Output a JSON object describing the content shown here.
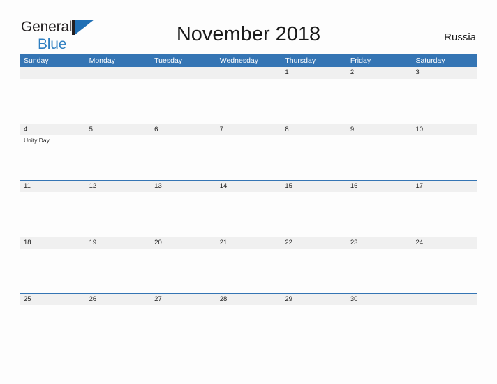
{
  "brand": {
    "name_part1": "General",
    "name_part2": "Blue",
    "mark_icon": "triangle-flag-icon",
    "accent_color": "#2f7fc1"
  },
  "header": {
    "title": "November 2018",
    "country": "Russia"
  },
  "theme": {
    "header_blue": "#3575b4",
    "row_gray": "#f0f0f0",
    "page_background": "#fdfdfd",
    "text_color": "#222222"
  },
  "calendar": {
    "weekdays": [
      "Sunday",
      "Monday",
      "Tuesday",
      "Wednesday",
      "Thursday",
      "Friday",
      "Saturday"
    ],
    "weeks": [
      {
        "days": [
          {
            "date": "",
            "events": []
          },
          {
            "date": "",
            "events": []
          },
          {
            "date": "",
            "events": []
          },
          {
            "date": "",
            "events": []
          },
          {
            "date": "1",
            "events": []
          },
          {
            "date": "2",
            "events": []
          },
          {
            "date": "3",
            "events": []
          }
        ]
      },
      {
        "days": [
          {
            "date": "4",
            "events": [
              "Unity Day"
            ]
          },
          {
            "date": "5",
            "events": []
          },
          {
            "date": "6",
            "events": []
          },
          {
            "date": "7",
            "events": []
          },
          {
            "date": "8",
            "events": []
          },
          {
            "date": "9",
            "events": []
          },
          {
            "date": "10",
            "events": []
          }
        ]
      },
      {
        "days": [
          {
            "date": "11",
            "events": []
          },
          {
            "date": "12",
            "events": []
          },
          {
            "date": "13",
            "events": []
          },
          {
            "date": "14",
            "events": []
          },
          {
            "date": "15",
            "events": []
          },
          {
            "date": "16",
            "events": []
          },
          {
            "date": "17",
            "events": []
          }
        ]
      },
      {
        "days": [
          {
            "date": "18",
            "events": []
          },
          {
            "date": "19",
            "events": []
          },
          {
            "date": "20",
            "events": []
          },
          {
            "date": "21",
            "events": []
          },
          {
            "date": "22",
            "events": []
          },
          {
            "date": "23",
            "events": []
          },
          {
            "date": "24",
            "events": []
          }
        ]
      },
      {
        "days": [
          {
            "date": "25",
            "events": []
          },
          {
            "date": "26",
            "events": []
          },
          {
            "date": "27",
            "events": []
          },
          {
            "date": "28",
            "events": []
          },
          {
            "date": "29",
            "events": []
          },
          {
            "date": "30",
            "events": []
          },
          {
            "date": "",
            "events": []
          }
        ]
      }
    ]
  }
}
